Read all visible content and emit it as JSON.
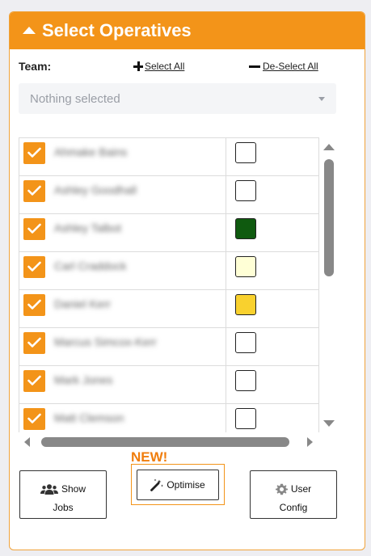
{
  "panel": {
    "title": "Select Operatives"
  },
  "team": {
    "label": "Team:",
    "select_all": "Select All",
    "deselect_all": "De-Select All",
    "placeholder": "Nothing selected"
  },
  "operatives": [
    {
      "name": "Ahmake Bains",
      "checked": true,
      "color": "#ffffff"
    },
    {
      "name": "Ashley Goodhall",
      "checked": true,
      "color": "#ffffff"
    },
    {
      "name": "Ashley Talbot",
      "checked": true,
      "color": "#0f5a0f"
    },
    {
      "name": "Carl Craddock",
      "checked": true,
      "color": "#ffffd6"
    },
    {
      "name": "Daniel Kerr",
      "checked": true,
      "color": "#f9d12e"
    },
    {
      "name": "Marcus Simcox-Kerr",
      "checked": true,
      "color": "#ffffff"
    },
    {
      "name": "Mark Jones",
      "checked": true,
      "color": "#ffffff"
    },
    {
      "name": "Matt Clemson",
      "checked": true,
      "color": "#ffffff"
    }
  ],
  "new_badge": "NEW!",
  "buttons": {
    "show": "Show",
    "jobs": "Jobs",
    "optimise": "Optimise",
    "user": "User",
    "config": "Config"
  },
  "colors": {
    "accent": "#f39419",
    "new": "#f07d0c"
  }
}
